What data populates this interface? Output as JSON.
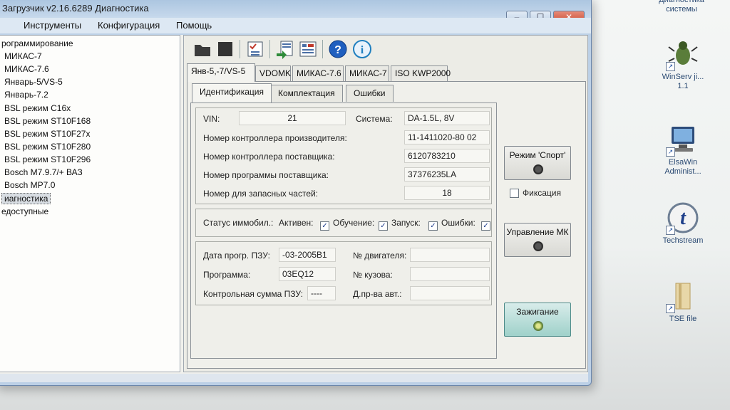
{
  "window": {
    "title": "Загрузчик v2.16.6289 Диагностика",
    "buttons": {
      "minimize": "–",
      "maximize": "☐",
      "close": "✕"
    }
  },
  "menu": [
    "Инструменты",
    "Конфигурация",
    "Помощь"
  ],
  "tree": {
    "items": [
      "рограммирование",
      "МИКАС-7",
      "МИКАС-7.6",
      "Январь-5/VS-5",
      "Январь-7.2",
      "BSL режим C16x",
      "BSL режим ST10F168",
      "BSL режим ST10F27x",
      "BSL режим ST10F280",
      "BSL режим ST10F296",
      "Bosch M7.9.7/+ ВАЗ",
      "Bosch MP7.0",
      "иагностика",
      "едоступные"
    ],
    "selected_index": 12
  },
  "toolbar": {
    "icons": [
      "open-folder-icon",
      "stop-icon",
      "checklist-icon",
      "export-icon",
      "settings-grid-icon",
      "help-icon",
      "info-icon"
    ]
  },
  "tabs": [
    "Янв-5,-7/VS-5",
    "VDOMK",
    "МИКАС-7.6",
    "МИКАС-7",
    "ISO KWP2000"
  ],
  "subtabs": [
    "Идентификация",
    "Комплектация",
    "Ошибки"
  ],
  "ident": {
    "vin_label": "VIN:",
    "vin_value": "21",
    "system_label": "Система:",
    "system_value": "DA-1.5L, 8V",
    "rows": [
      {
        "label": "Номер контроллера производителя:",
        "value": "11-1411020-80 02"
      },
      {
        "label": "Номер контроллера поставщика:",
        "value": "6120783210"
      },
      {
        "label": "Номер программы поставщика:",
        "value": "37376235LA"
      },
      {
        "label": "Номер для запасных частей:",
        "value": "18"
      }
    ]
  },
  "immo": {
    "label": "Статус иммобил.:",
    "flags": [
      {
        "label": "Активен:",
        "checked": true
      },
      {
        "label": "Обучение:",
        "checked": true
      },
      {
        "label": "Запуск:",
        "checked": true
      },
      {
        "label": "Ошибки:",
        "checked": true
      }
    ]
  },
  "rom": {
    "date_label": "Дата прогр. ПЗУ:",
    "date_value": "-03-2005B1",
    "program_label": "Программа:",
    "program_value": "03EQ12",
    "checksum_label": "Контрольная сумма ПЗУ:",
    "checksum_value": "----",
    "engine_label": "№ двигателя:",
    "engine_value": "",
    "body_label": "№ кузова:",
    "body_value": "",
    "prod_label": "Д.пр-ва авт.:",
    "prod_value": ""
  },
  "side": {
    "sport_label": "Режим 'Спорт'",
    "fix_label": "Фиксация",
    "control_label": "Управление МК",
    "ignition_label": "Зажигание"
  },
  "desktop": {
    "icons": [
      {
        "label": "Диагностика системы",
        "icon": "diagnostics-icon"
      },
      {
        "label": "WinServ ji... 1.1",
        "icon": "bug-icon"
      },
      {
        "label": "ElsaWin Administ...",
        "icon": "computer-icon"
      },
      {
        "label": "Techstream",
        "icon": "techstream-icon"
      },
      {
        "label": "TSE file",
        "icon": "folder-icon"
      }
    ],
    "accent": "#1f4fa0"
  }
}
